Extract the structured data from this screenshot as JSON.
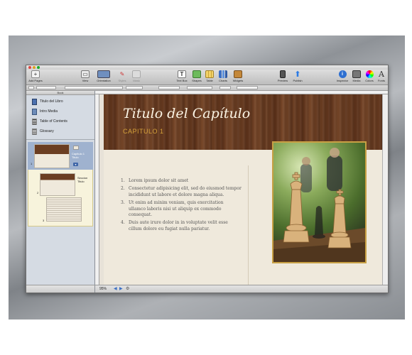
{
  "toolbar": {
    "add_pages": "Add Pages",
    "view": "View",
    "orientation": "Orientation",
    "styles": "Styles",
    "mask": "Mask",
    "text_box": "Text Box",
    "shapes": "Shapes",
    "table": "Table",
    "charts": "Charts",
    "widgets": "Widgets",
    "preview": "Preview",
    "publish": "Publish",
    "inspector": "Inspector",
    "media": "Media",
    "colors": "Colors",
    "fonts": "Fonts"
  },
  "sidebar": {
    "header": "Book",
    "items": [
      {
        "label": "Titulo del Libro",
        "icon": "book-icon"
      },
      {
        "label": "Intro Media",
        "icon": "intro-media-icon"
      },
      {
        "label": "Table of Contents",
        "icon": "toc-icon"
      },
      {
        "label": "Glossary",
        "icon": "glossary-icon"
      }
    ],
    "thumbnails": [
      {
        "number": "1",
        "label": "Capitulo 1 Titulo"
      },
      {
        "number": "2",
        "label": "Seccion Titulo"
      },
      {
        "number": "3",
        "label": ""
      }
    ]
  },
  "status": {
    "zoom": "95%"
  },
  "document": {
    "chapter_title": "Titulo  del Capítulo",
    "chapter_subtitle": "CAPITULO 1",
    "list": [
      {
        "num": "1.",
        "text": "Lorem ipsum dolor sit amet"
      },
      {
        "num": "2.",
        "text": "Consectetur adipisicing elit, sed do eiusmod tempor incididunt ut labore et dolore magna aliqua."
      },
      {
        "num": "3.",
        "text": "Ut enim ad minim veniam, quis exercitation ullamco laboris nisi ut aliquip ex commodo consequat."
      },
      {
        "num": "4.",
        "text": "Duis aute irure dolor in in voluptate velit esse cillum dolore eu fugiat nulla pariatur."
      }
    ]
  },
  "colors": {
    "wood": "#6b3e22",
    "accent_gold": "#d6a23a",
    "selection": "#9fb2cf"
  }
}
